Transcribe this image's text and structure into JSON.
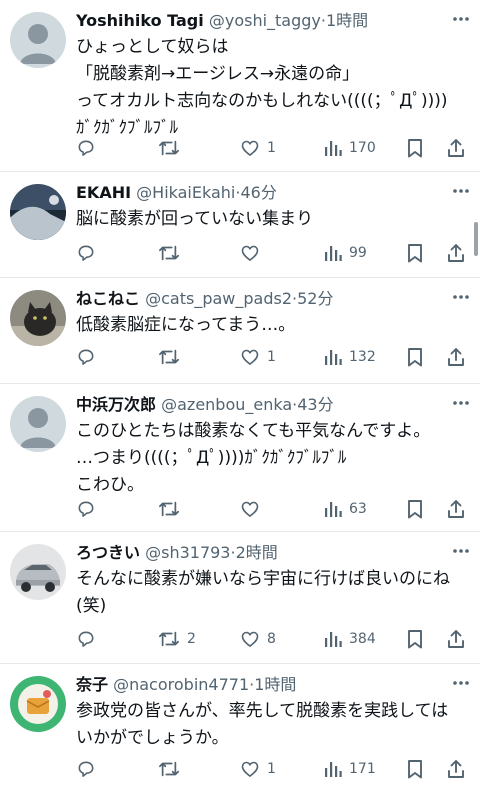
{
  "icons": {
    "reply": "reply-icon",
    "retweet": "retweet-icon",
    "like": "heart-icon",
    "views": "views-icon",
    "bookmark": "bookmark-icon",
    "share": "share-icon",
    "more": "more-icon"
  },
  "colors": {
    "secondary_text": "#536471",
    "divider": "#e6e9ec",
    "primary_text": "#0f1419"
  },
  "posts": [
    {
      "name": "Yoshihiko Tagi",
      "handle": "@yoshi_taggy",
      "dot": "·",
      "time": "1時間",
      "lines": [
        "ひょっとして奴らは",
        "「脱酸素剤→エージレス→永遠の命」",
        "ってオカルト志向なのかもしれない((((；ﾟДﾟ))))",
        "ｶﾞｸｶﾞｸﾌﾞﾙﾌﾞﾙ"
      ],
      "replies": "",
      "retweets": "",
      "likes": "1",
      "views": "170"
    },
    {
      "name": "EKAHI",
      "handle": "@HikaiEkahi",
      "dot": "·",
      "time": "46分",
      "lines": [
        "脳に酸素が回っていない集まり"
      ],
      "replies": "",
      "retweets": "",
      "likes": "",
      "views": "99"
    },
    {
      "name": "ねこねこ",
      "handle": "@cats_paw_pads2",
      "dot": "·",
      "time": "52分",
      "lines": [
        "低酸素脳症になってまう…。"
      ],
      "replies": "",
      "retweets": "",
      "likes": "1",
      "views": "132"
    },
    {
      "name": "中浜万次郎",
      "handle": "@azenbou_enka",
      "dot": "·",
      "time": "43分",
      "lines": [
        "このひとたちは酸素なくても平気なんですよ。",
        "…つまり((((；ﾟДﾟ))))ｶﾞｸｶﾞｸﾌﾞﾙﾌﾞﾙ",
        "こわひ。"
      ],
      "replies": "",
      "retweets": "",
      "likes": "",
      "views": "63"
    },
    {
      "name": "ろつきい",
      "handle": "@sh31793",
      "dot": "·",
      "time": "2時間",
      "lines": [
        "そんなに酸素が嫌いなら宇宙に行けば良いのにね",
        "(笑)"
      ],
      "replies": "",
      "retweets": "2",
      "likes": "8",
      "views": "384"
    },
    {
      "name": "奈子",
      "handle": "@nacorobin4771",
      "dot": "·",
      "time": "1時間",
      "lines": [
        "参政党の皆さんが、率先して脱酸素を実践しては",
        "いかがでしょうか。"
      ],
      "replies": "",
      "retweets": "",
      "likes": "1",
      "views": "171"
    }
  ]
}
